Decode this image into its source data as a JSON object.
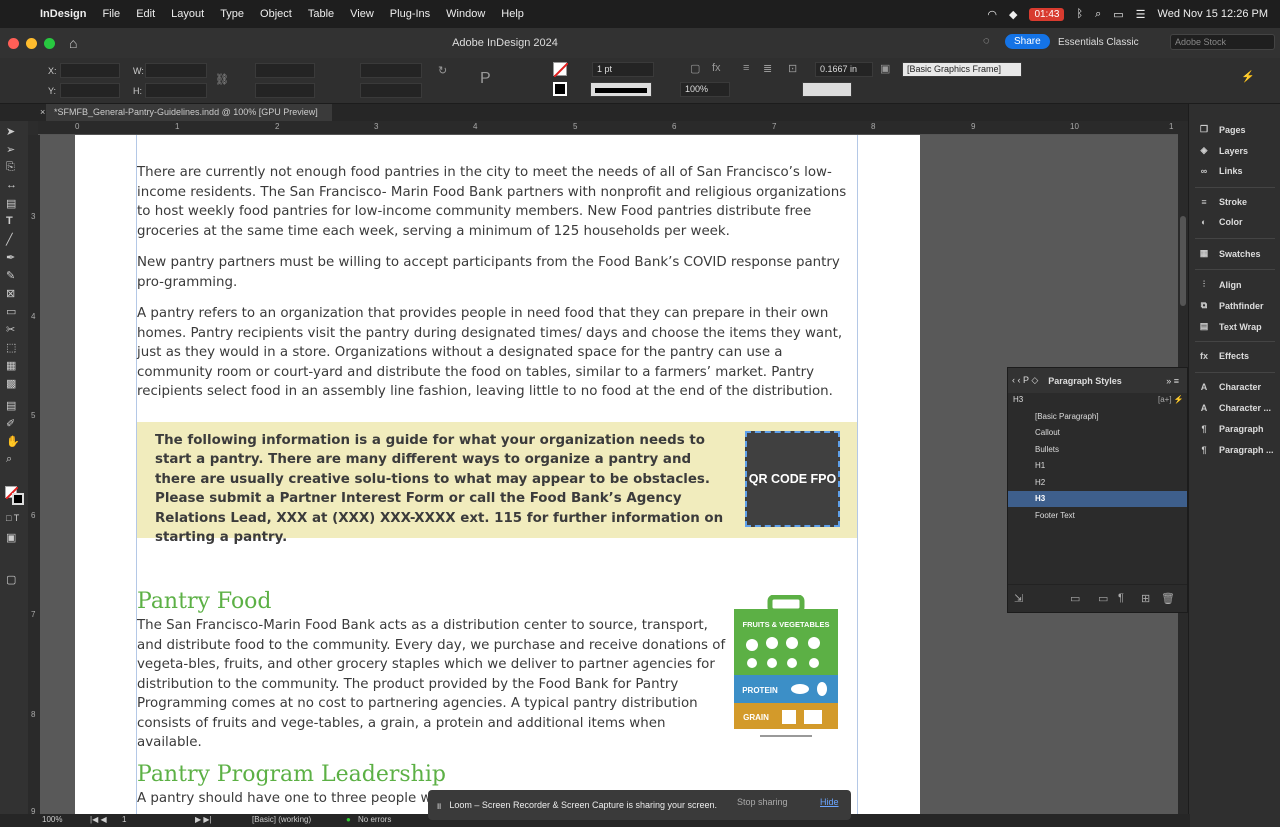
{
  "menubar": {
    "app": "InDesign",
    "items": [
      "File",
      "Edit",
      "Layout",
      "Type",
      "Object",
      "Table",
      "View",
      "Plug-Ins",
      "Window",
      "Help"
    ],
    "recording_time": "01:43",
    "datetime": "Wed Nov 15  12:26 PM"
  },
  "titlebar": {
    "title": "Adobe InDesign 2024",
    "share": "Share",
    "workspace": "Essentials Classic",
    "search_placeholder": "Adobe Stock"
  },
  "control": {
    "x_label": "X:",
    "y_label": "Y:",
    "w_label": "W:",
    "h_label": "H:",
    "stroke_weight": "1 pt",
    "opacity": "100%",
    "offset": "0.1667 in",
    "frame_style": "[Basic Graphics Frame]"
  },
  "document": {
    "tab": "*SFMFB_General-Pantry-Guidelines.indd @ 100% [GPU Preview]"
  },
  "ruler": {
    "h": [
      "0",
      "1",
      "2",
      "3",
      "4",
      "5",
      "6",
      "7",
      "8",
      "9",
      "10",
      "1"
    ],
    "v": [
      "3",
      "4",
      "5",
      "6",
      "7",
      "8",
      "9"
    ]
  },
  "page": {
    "p1": "There are currently not enough food pantries in the city to meet the needs of all of San Francisco’s low-income residents. The San Francisco- Marin Food Bank partners with nonprofit and religious organizations to host weekly food pantries for low-income community members. New Food pantries distribute free groceries at the same time each week, serving a minimum of 125 households per week.",
    "p2": "New pantry partners must be willing to accept participants from the Food Bank’s COVID response pantry pro-gramming.",
    "p3": "A pantry refers to an organization that provides people in need food that they can prepare in their own homes. Pantry recipients visit the pantry during designated times/ days and choose the items they want, just as they would in a store. Organizations without a designated space for the pantry can use a community room or court-yard and distribute the food on tables, similar to a farmers’ market. Pantry recipients select food in an assembly line fashion, leaving little to no food at the end of the distribution.",
    "callout": "The following information is a guide for what your organization needs to start a pantry. There are many different ways to organize a pantry and there are usually creative solu-tions to what may appear to be obstacles. Please submit a Partner Interest Form or call the Food Bank’s Agency Relations Lead, XXX at (XXX) XXX-XXXX ext. 115 for further information on starting a pantry.",
    "qr": "QR CODE FPO",
    "h_food": "Pantry Food",
    "p_food": "The San Francisco-Marin Food Bank acts as a distribution center to source, transport, and distribute food to the community. Every day, we purchase and receive donations of vegeta-bles, fruits, and other grocery staples which we deliver to partner agencies for distribution to the community. The product provided by the Food Bank for Pantry Programming comes at no cost to partnering agencies. A typical pantry distribution consists of fruits and vege-tables, a grain, a protein and additional items when available.",
    "bag_fruits": "FRUITS & VEGETABLES",
    "bag_protein": "PROTEIN",
    "bag_grain": "GRAIN",
    "h_lead": "Pantry Program Leadership",
    "p_lead": "A pantry should have one to three people who"
  },
  "right_panel": [
    "Pages",
    "Layers",
    "Links",
    "Stroke",
    "Color",
    "Swatches",
    "Align",
    "Pathfinder",
    "Text Wrap",
    "Effects",
    "Character",
    "Character ...",
    "Paragraph",
    "Paragraph ..."
  ],
  "paragraph_styles": {
    "title": "Paragraph Styles",
    "current": "H3",
    "items": [
      "[Basic Paragraph]",
      "Callout",
      "Bullets",
      "H1",
      "H2",
      "H3",
      "Footer Text"
    ],
    "selected_index": 5
  },
  "status": {
    "zoom": "100%",
    "page": "1",
    "profile": "[Basic] (working)",
    "errors": "No errors"
  },
  "loom": {
    "message": "Loom – Screen Recorder & Screen Capture is sharing your screen.",
    "stop": "Stop sharing",
    "hide": "Hide"
  }
}
